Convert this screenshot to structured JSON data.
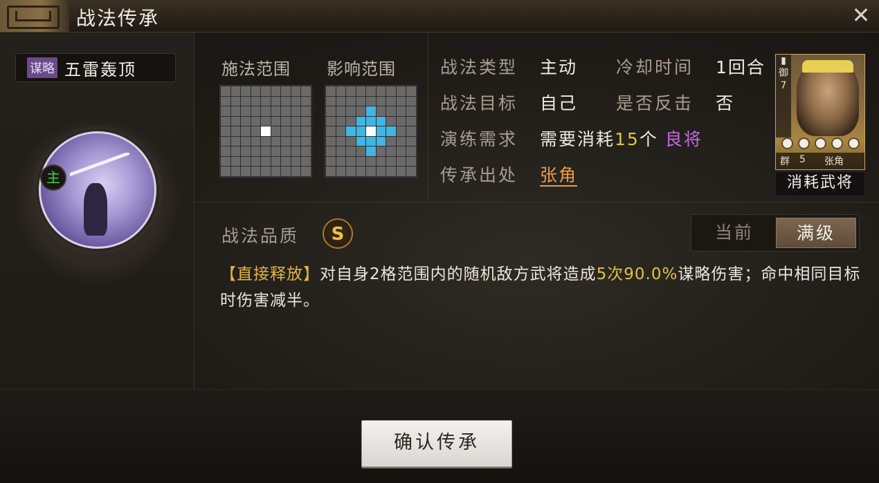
{
  "window": {
    "title": "战法传承",
    "close_label": "✕"
  },
  "skill": {
    "tag": "谋略",
    "name": "五雷轰顶",
    "main_badge": "主"
  },
  "range": {
    "cast_label": "施法范围",
    "effect_label": "影响范围"
  },
  "info": {
    "type_label": "战法类型",
    "type_value": "主动",
    "cooldown_label": "冷却时间",
    "cooldown_value": "1回合",
    "target_label": "战法目标",
    "target_value": "自己",
    "counter_label": "是否反击",
    "counter_value": "否",
    "drill_label": "演练需求",
    "drill_prefix": "需要消耗",
    "drill_count": "15",
    "drill_unit": "个",
    "drill_item": "良将",
    "origin_label": "传承出处",
    "origin_value": "张角"
  },
  "hero_card": {
    "side_text": "御 7",
    "faction": "群",
    "cost": "5",
    "name": "张角",
    "caption": "消耗武将"
  },
  "quality": {
    "label": "战法品质",
    "grade": "S",
    "toggle_current": "当前",
    "toggle_max": "满级"
  },
  "description": {
    "tag": "【直接释放】",
    "part1": "对自身2格范围内的随机敌方武将造成",
    "times": "5次",
    "percent": "90.0%",
    "part2": "谋略伤害；命中相同目标时伤害减半。"
  },
  "confirm_label": "确认传承",
  "colors": {
    "accent_yellow": "#e3c23e",
    "accent_purple": "#c56ae6",
    "accent_orange": "#ee9e3c",
    "area_blue": "#3fb6e6",
    "main_green": "#3fcf4f"
  }
}
